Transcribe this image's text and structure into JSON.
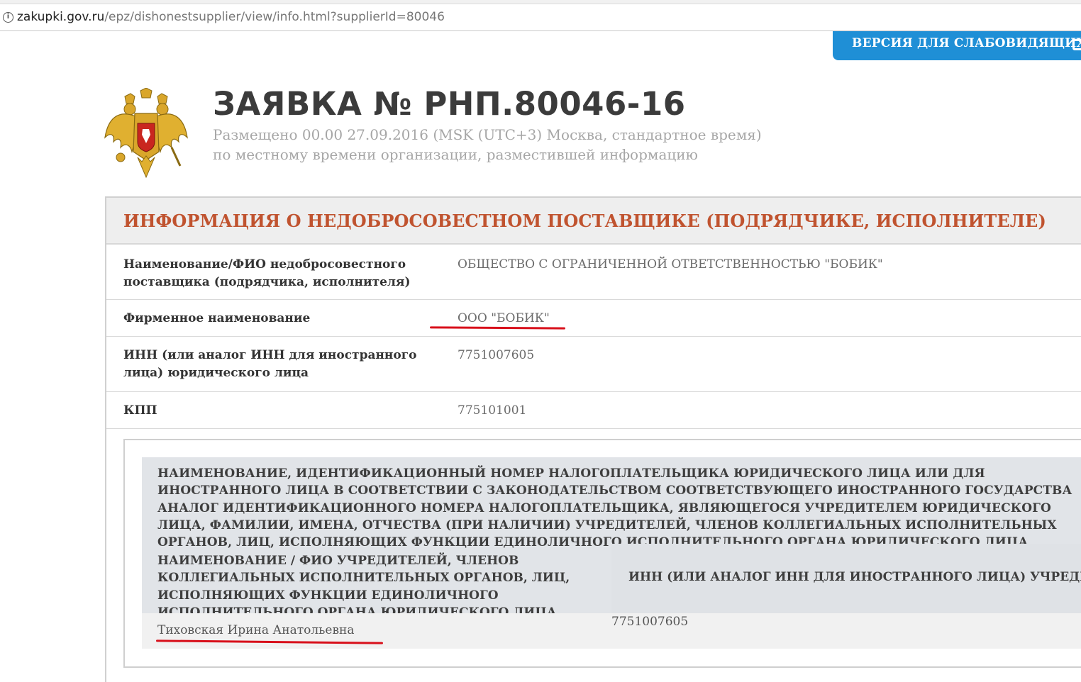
{
  "browser": {
    "url_domain": "zakupki.gov.ru",
    "url_path": "/epz/dishonestsupplier/view/info.html?supplierId=80046"
  },
  "accessibility_button": {
    "label": "ВЕРСИЯ ДЛЯ СЛАБОВИДЯЩИХ",
    "icon": "glasses-icon"
  },
  "header": {
    "emblem": "russian-coat-of-arms",
    "title": "ЗАЯВКА № РНП.80046-16",
    "placed_line1": "Размещено 00.00 27.09.2016 (MSK (UTC+3) Москва, стандартное время)",
    "placed_line2": "по местному времени организации, разместившей информацию"
  },
  "panel": {
    "title": "ИНФОРМАЦИЯ О НЕДОБРОСОВЕСТНОМ ПОСТАВЩИКЕ (ПОДРЯДЧИКЕ, ИСПОЛНИТЕЛЕ)",
    "rows": [
      {
        "label": "Наименование/ФИО недобросовестного поставщика (подрядчика, исполнителя)",
        "value": "ОБЩЕСТВО С ОГРАНИЧЕННОЙ ОТВЕТСТВЕННОСТЬЮ \"БОБИК\""
      },
      {
        "label": "Фирменное наименование",
        "value": "ООО \"БОБИК\""
      },
      {
        "label": "ИНН (или аналог ИНН для иностранного лица) юридического лица",
        "value": "7751007605"
      },
      {
        "label": "КПП",
        "value": "775101001"
      }
    ]
  },
  "founders": {
    "section_title": "НАИМЕНОВАНИЕ, ИДЕНТИФИКАЦИОННЫЙ НОМЕР НАЛОГОПЛАТЕЛЬЩИКА ЮРИДИЧЕСКОГО ЛИЦА ИЛИ ДЛЯ ИНОСТРАННОГО ЛИЦА В СООТВЕТСТВИИ С ЗАКОНОДАТЕЛЬСТВОМ СООТВЕТСТВУЮЩЕГО ИНОСТРАННОГО ГОСУДАРСТВА АНАЛОГ ИДЕНТИФИКАЦИОННОГО НОМЕРА НАЛОГОПЛАТЕЛЬЩИКА, ЯВЛЯЮЩЕГОСЯ УЧРЕДИТЕЛЕМ ЮРИДИЧЕСКОГО ЛИЦА, ФАМИЛИИ, ИМЕНА, ОТЧЕСТВА (ПРИ НАЛИЧИИ) УЧРЕДИТЕЛЕЙ, ЧЛЕНОВ КОЛЛЕГИАЛЬНЫХ ИСПОЛНИТЕЛЬНЫХ ОРГАНОВ, ЛИЦ, ИСПОЛНЯЮЩИХ ФУНКЦИИ ЕДИНОЛИЧНОГО ИСПОЛНИТЕЛЬНОГО ОРГАНА ЮРИДИЧЕСКОГО ЛИЦА",
    "col_name_header": "НАИМЕНОВАНИЕ / ФИО УЧРЕДИТЕЛЕЙ, ЧЛЕНОВ КОЛЛЕГИАЛЬНЫХ ИСПОЛНИТЕЛЬНЫХ ОРГАНОВ, ЛИЦ, ИСПОЛНЯЮЩИХ ФУНКЦИИ ЕДИНОЛИЧНОГО ИСПОЛНИТЕЛЬНОГО ОРГАНА ЮРИДИЧЕСКОГО ЛИЦА",
    "col_inn_header": "ИНН (ИЛИ АНАЛОГ ИНН ДЛЯ ИНОСТРАННОГО ЛИЦА) УЧРЕДИТЕЛЯ",
    "rows": [
      {
        "name": "Тиховская Ирина Анатольевна",
        "inn": "7751007605"
      }
    ]
  },
  "annotation_color": "#d8101b"
}
